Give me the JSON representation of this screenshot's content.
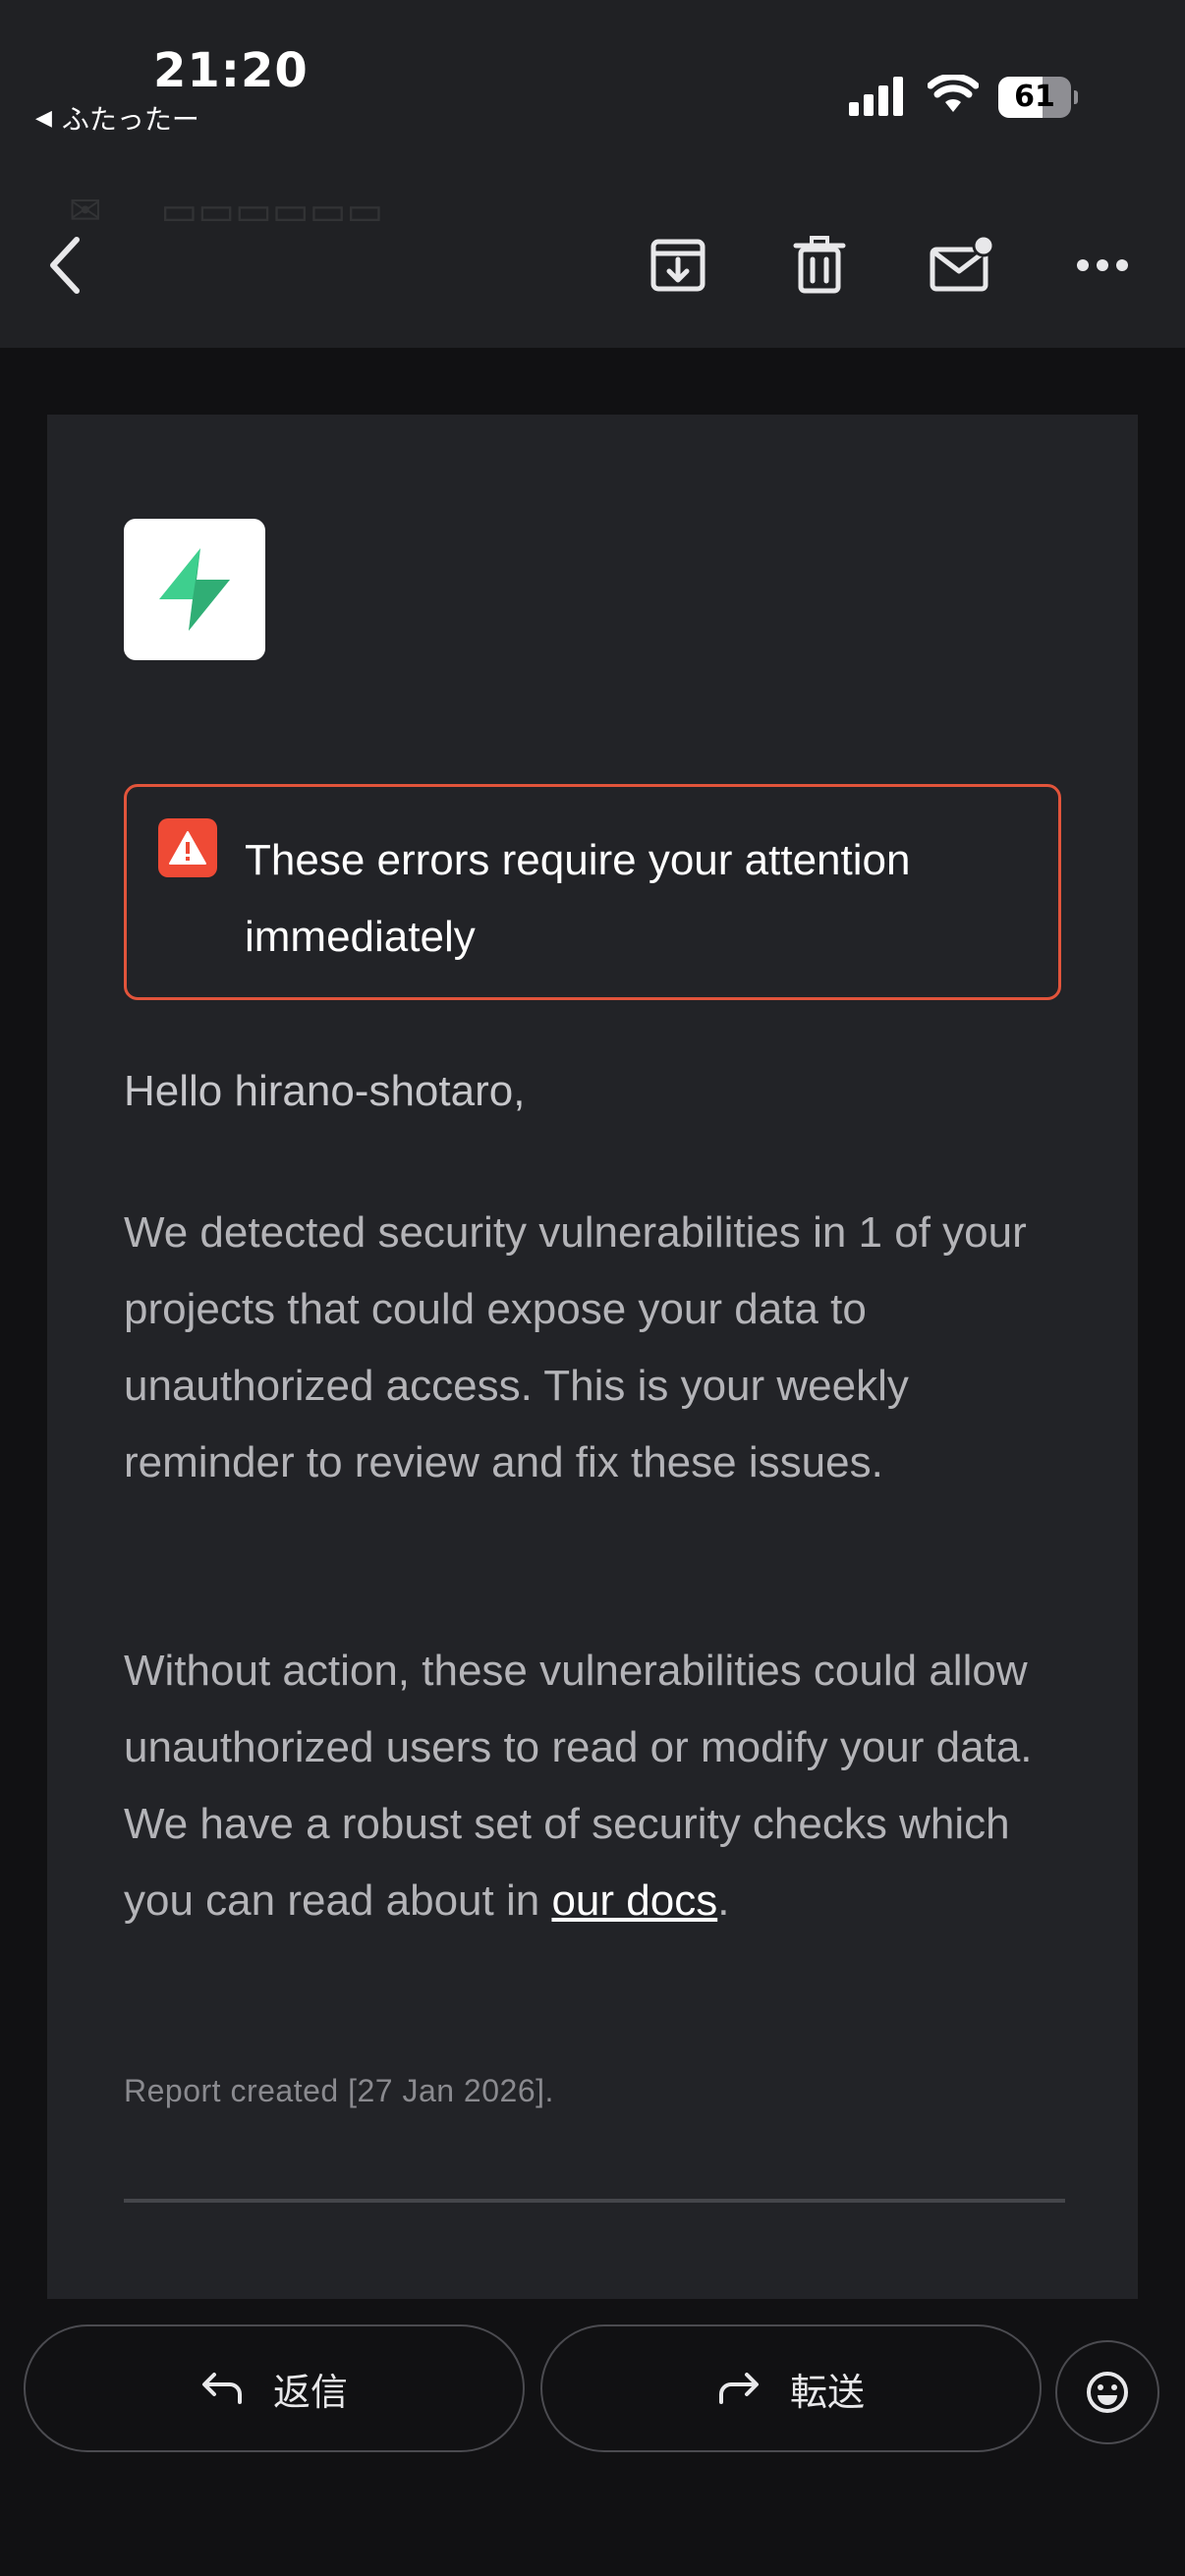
{
  "status_bar": {
    "time": "21:20",
    "back_app": "ふたったー",
    "back_app_arrow": "◀",
    "battery_level": 61,
    "battery_text": "61"
  },
  "toolbar": {
    "icons": [
      "back-arrow-icon",
      "archive-icon",
      "trash-icon",
      "mark-unread-icon",
      "more-icon"
    ]
  },
  "email": {
    "alert_text": "These errors require your attention immediately",
    "greeting": "Hello hirano-shotaro,",
    "paragraph1": "We detected security vulnerabilities in 1 of your projects that could expose your data to unauthorized access. This is your weekly reminder to review and fix these issues.",
    "paragraph2_prefix": "Without action, these vulnerabilities could allow unauthorized users to read or modify your data. We have a robust set of security checks which you can read about in ",
    "paragraph2_link": "our docs",
    "paragraph2_suffix": ".",
    "report": "Report created [27 Jan 2026]."
  },
  "actions": {
    "reply_label": "返信",
    "forward_label": "転送"
  },
  "colors": {
    "accent_green": "#3ecf8e",
    "alert_red": "#ef4a35",
    "alert_border": "#e2543b"
  }
}
